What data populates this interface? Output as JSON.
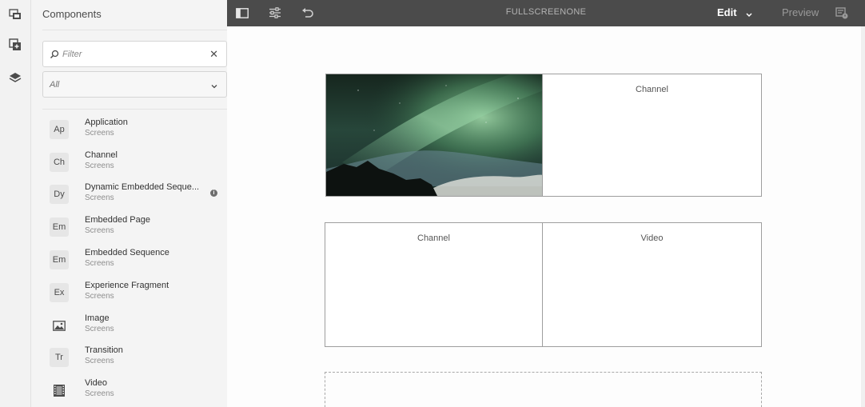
{
  "rail": {
    "items": [
      {
        "icon": "page-panels-icon"
      },
      {
        "icon": "add-components-icon"
      },
      {
        "icon": "layers-icon"
      }
    ]
  },
  "panel": {
    "title": "Components",
    "filter": {
      "placeholder": "Filter",
      "value": "",
      "clear_icon": "close-icon"
    },
    "group": {
      "selected": "All"
    },
    "components": [
      {
        "badge": "Ap",
        "name": "Application",
        "group": "Screens"
      },
      {
        "badge": "Ch",
        "name": "Channel",
        "group": "Screens"
      },
      {
        "badge": "Dy",
        "name": "Dynamic Embedded Seque...",
        "group": "Screens",
        "info": true
      },
      {
        "badge": "Em",
        "name": "Embedded Page",
        "group": "Screens"
      },
      {
        "badge": "Em",
        "name": "Embedded Sequence",
        "group": "Screens"
      },
      {
        "badge": "Ex",
        "name": "Experience Fragment",
        "group": "Screens"
      },
      {
        "badge": "",
        "icon": "image-icon",
        "name": "Image",
        "group": "Screens"
      },
      {
        "badge": "Tr",
        "name": "Transition",
        "group": "Screens"
      },
      {
        "badge": "",
        "icon": "film-icon",
        "name": "Video",
        "group": "Screens"
      }
    ]
  },
  "topbar": {
    "title": "FULLSCREENONE",
    "mode": "Edit",
    "preview": "Preview"
  },
  "canvas": {
    "cells": [
      {
        "label": "Channel"
      },
      {
        "label": "Channel"
      },
      {
        "label": "Video"
      }
    ]
  },
  "colors": {
    "topbar": "#4b4b4b",
    "panel": "#f4f4f4",
    "canvas": "#fdfdfd"
  }
}
